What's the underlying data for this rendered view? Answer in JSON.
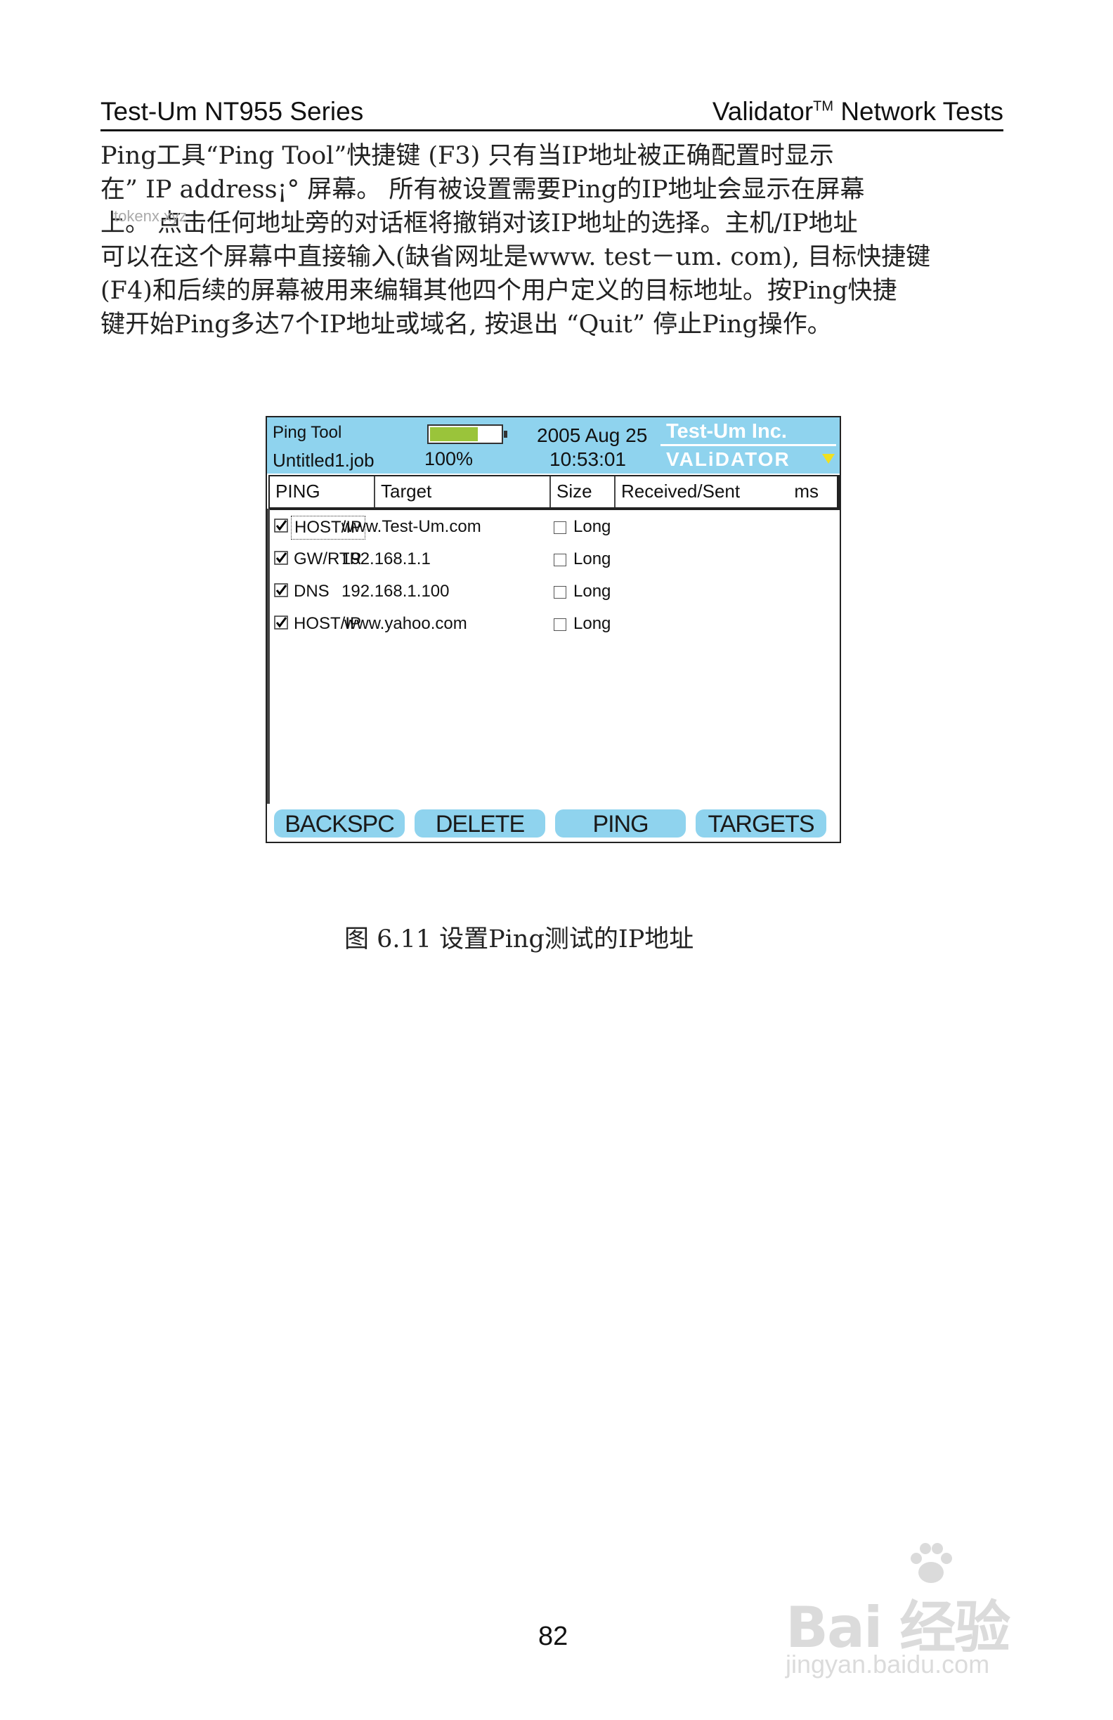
{
  "header": {
    "left": "Test-Um NT955 Series",
    "right_main": "Validator",
    "right_tm": "TM",
    "right_tail": " Network Tests"
  },
  "paragraph": [
    "Ping工具“Ping Tool”快捷键 (F3) 只有当IP地址被正确配置时显示",
    "在” IP address¡° 屏幕。 所有被设置需要Ping的IP地址会显示在屏幕",
    "上。  点击任何地址旁的对话框将撤销对该IP地址的选择。主机/IP地址",
    "可以在这个屏幕中直接输入(缺省网址是www. test－um. com), 目标快捷键",
    "(F4)和后续的屏幕被用来编辑其他四个用户定义的目标地址。按Ping快捷",
    "键开始Ping多达7个IP地址或域名, 按退出 “Quit” 停止Ping操作。"
  ],
  "watermark_small": "tokenx.xyz",
  "screen": {
    "tool_name": "Ping Tool",
    "job_name": "Untitled1.job",
    "battery_percent": "100%",
    "battery_level": 1.0,
    "date": "2005 Aug 25",
    "time": "10:53:01",
    "brand": "Test-Um Inc.",
    "brand_sub": "VALiDATOR",
    "columns": {
      "ping": "PING",
      "target": "Target",
      "size": "Size",
      "received": "Received/Sent",
      "ms": "ms"
    },
    "rows": [
      {
        "type": "HOST/IP",
        "target": "www.Test-Um.com",
        "checked": true,
        "long_label": "Long",
        "long_checked": false
      },
      {
        "type": "GW/RTR",
        "target": "192.168.1.1",
        "checked": true,
        "long_label": "Long",
        "long_checked": false
      },
      {
        "type": "DNS",
        "target": "192.168.1.100",
        "checked": true,
        "long_label": "Long",
        "long_checked": false
      },
      {
        "type": "HOST/IP",
        "target": "www.yahoo.com",
        "checked": true,
        "long_label": "Long",
        "long_checked": false
      }
    ],
    "softkeys": [
      "BACKSPC",
      "DELETE",
      "PING",
      "TARGETS"
    ]
  },
  "caption": "图 6.11    设置Ping测试的IP地址",
  "page_number": "82",
  "baidu_logo_text": "Bai 经验",
  "baidu_url": "jingyan.baidu.com",
  "colors": {
    "screen_accent": "#8fd3ee",
    "battery_fill": "#9ac43a",
    "validator_arrow": "#f0e020"
  }
}
